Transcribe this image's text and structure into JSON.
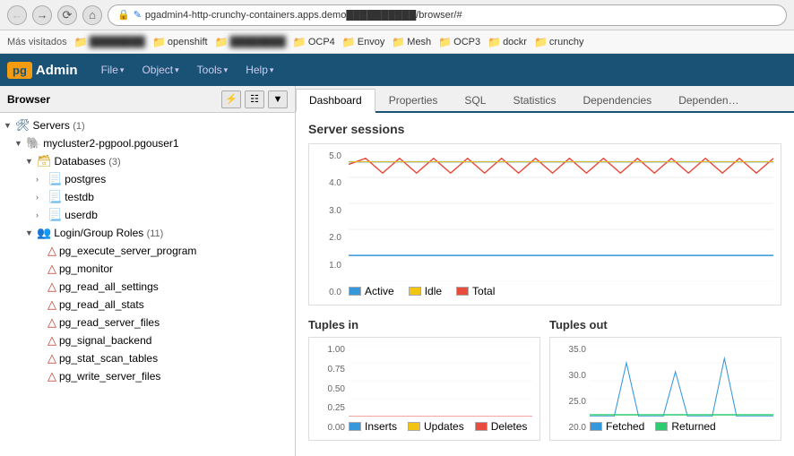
{
  "browser": {
    "back_btn": "←",
    "forward_btn": "→",
    "reload_btn": "↻",
    "home_btn": "⌂",
    "address": "pgadmin4-http-crunchy-containers.apps.demo██████████/browser/#",
    "lock_icon": "🔒",
    "edit_icon": "✎"
  },
  "bookmarks": {
    "label": "Más visitados",
    "items": [
      {
        "label": "████████████",
        "icon": "📁"
      },
      {
        "label": "openshift",
        "icon": "📁"
      },
      {
        "label": "████████████",
        "icon": "📁"
      },
      {
        "label": "OCP4",
        "icon": "📁"
      },
      {
        "label": "Envoy",
        "icon": "📁"
      },
      {
        "label": "Mesh",
        "icon": "📁"
      },
      {
        "label": "OCP3",
        "icon": "📁"
      },
      {
        "label": "dockr",
        "icon": "📁"
      },
      {
        "label": "crunchy",
        "icon": "📁"
      }
    ]
  },
  "pgadmin": {
    "logo": "pg",
    "title": "Admin",
    "menus": [
      {
        "label": "File",
        "has_arrow": true
      },
      {
        "label": "Object",
        "has_arrow": true
      },
      {
        "label": "Tools",
        "has_arrow": true
      },
      {
        "label": "Help",
        "has_arrow": true
      }
    ]
  },
  "sidebar": {
    "title": "Browser",
    "tool_btns": [
      "⚡",
      "☰",
      "▼"
    ],
    "tree": [
      {
        "indent": 0,
        "arrow": "▼",
        "icon": "🖥",
        "label": "Servers (1)",
        "icon_class": "icon-server"
      },
      {
        "indent": 1,
        "arrow": "▼",
        "icon": "🐘",
        "label": "mycluster2-pgpool.pgouser1",
        "icon_class": "icon-server"
      },
      {
        "indent": 2,
        "arrow": "▼",
        "icon": "🗄",
        "label": "Databases (3)",
        "icon_class": "icon-db"
      },
      {
        "indent": 3,
        "arrow": "›",
        "icon": "🗃",
        "label": "postgres",
        "icon_class": "icon-table"
      },
      {
        "indent": 3,
        "arrow": "›",
        "icon": "🗃",
        "label": "testdb",
        "icon_class": "icon-table"
      },
      {
        "indent": 3,
        "arrow": "›",
        "icon": "🗃",
        "label": "userdb",
        "icon_class": "icon-table"
      },
      {
        "indent": 2,
        "arrow": "▼",
        "icon": "👥",
        "label": "Login/Group Roles (11)",
        "icon_class": "icon-role"
      },
      {
        "indent": 3,
        "arrow": "",
        "icon": "👤",
        "label": "pg_execute_server_program",
        "icon_class": "icon-role"
      },
      {
        "indent": 3,
        "arrow": "",
        "icon": "👤",
        "label": "pg_monitor",
        "icon_class": "icon-role"
      },
      {
        "indent": 3,
        "arrow": "",
        "icon": "👤",
        "label": "pg_read_all_settings",
        "icon_class": "icon-role"
      },
      {
        "indent": 3,
        "arrow": "",
        "icon": "👤",
        "label": "pg_read_all_stats",
        "icon_class": "icon-role"
      },
      {
        "indent": 3,
        "arrow": "",
        "icon": "👤",
        "label": "pg_read_server_files",
        "icon_class": "icon-role"
      },
      {
        "indent": 3,
        "arrow": "",
        "icon": "👤",
        "label": "pg_signal_backend",
        "icon_class": "icon-role"
      },
      {
        "indent": 3,
        "arrow": "",
        "icon": "👤",
        "label": "pg_stat_scan_tables",
        "icon_class": "icon-role"
      },
      {
        "indent": 3,
        "arrow": "",
        "icon": "👤",
        "label": "pg_write_server_files",
        "icon_class": "icon-role"
      }
    ]
  },
  "tabs": [
    {
      "label": "Dashboard",
      "active": true
    },
    {
      "label": "Properties",
      "active": false
    },
    {
      "label": "SQL",
      "active": false
    },
    {
      "label": "Statistics",
      "active": false
    },
    {
      "label": "Dependencies",
      "active": false
    },
    {
      "label": "Dependen…",
      "active": false
    }
  ],
  "dashboard": {
    "server_sessions_title": "Server sessions",
    "server_sessions_legend": [
      {
        "label": "Active",
        "color": "#3498db"
      },
      {
        "label": "Idle",
        "color": "#f1c40f"
      },
      {
        "label": "Total",
        "color": "#e74c3c"
      }
    ],
    "server_sessions_y": [
      "5.0",
      "4.0",
      "3.0",
      "2.0",
      "1.0",
      "0.0"
    ],
    "tuples_in_title": "Tuples in",
    "tuples_in_legend": [
      {
        "label": "Inserts",
        "color": "#3498db"
      },
      {
        "label": "Updates",
        "color": "#f1c40f"
      },
      {
        "label": "Deletes",
        "color": "#e74c3c"
      }
    ],
    "tuples_in_y": [
      "1.00"
    ],
    "tuples_out_title": "Tuples out",
    "tuples_out_legend": [
      {
        "label": "Fetched",
        "color": "#3498db"
      },
      {
        "label": "Returned",
        "color": "#2ecc71"
      }
    ],
    "tuples_out_y": [
      "35.0",
      "30.0",
      "25.0",
      "20.0"
    ]
  }
}
